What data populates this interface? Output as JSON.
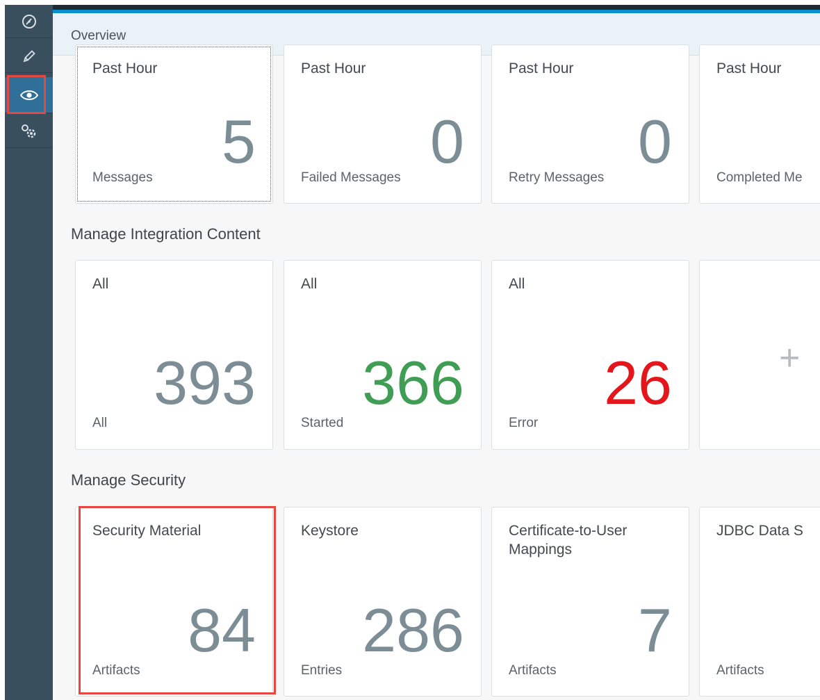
{
  "nav": {
    "items": [
      {
        "name": "monitor-dashboard-icon"
      },
      {
        "name": "pencil-icon"
      },
      {
        "name": "eye-icon"
      },
      {
        "name": "gears-icon"
      }
    ],
    "active_index": 2
  },
  "header": {
    "title": "Overview"
  },
  "message_tiles": [
    {
      "title": "Past Hour",
      "value": "5",
      "footer": "Messages"
    },
    {
      "title": "Past Hour",
      "value": "0",
      "footer": "Failed Messages"
    },
    {
      "title": "Past Hour",
      "value": "0",
      "footer": "Retry Messages"
    },
    {
      "title": "Past Hour",
      "value": "",
      "footer": "Completed Me"
    }
  ],
  "integration": {
    "title": "Manage Integration Content",
    "tiles": [
      {
        "title": "All",
        "value": "393",
        "footer": "All",
        "color": "#7c8d95"
      },
      {
        "title": "All",
        "value": "366",
        "footer": "Started",
        "color": "#3f9e53"
      },
      {
        "title": "All",
        "value": "26",
        "footer": "Error",
        "color": "#e4161b"
      }
    ],
    "add_symbol": "+"
  },
  "security": {
    "title": "Manage Security",
    "tiles": [
      {
        "title": "Security Material",
        "value": "84",
        "footer": "Artifacts"
      },
      {
        "title": "Keystore",
        "value": "286",
        "footer": "Entries"
      },
      {
        "title": "Certificate-to-User Mappings",
        "value": "7",
        "footer": "Artifacts"
      },
      {
        "title": "JDBC Data S",
        "value": "",
        "footer": "Artifacts"
      }
    ]
  }
}
